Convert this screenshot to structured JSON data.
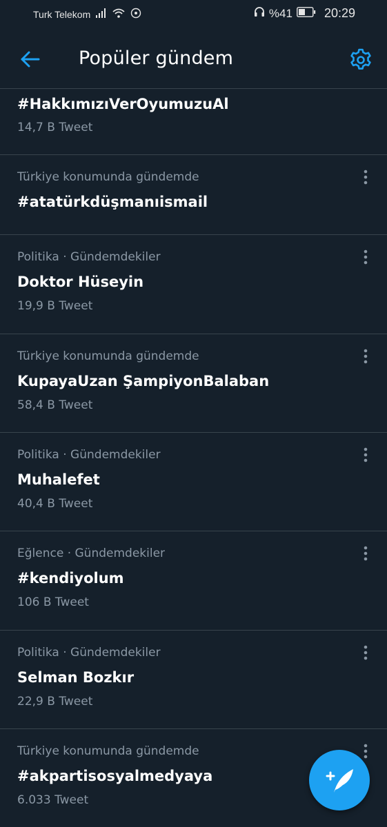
{
  "status_bar": {
    "carrier": "Turk Telekom",
    "battery": "%41",
    "time": "20:29"
  },
  "header": {
    "title": "Popüler gündem",
    "back_icon": "arrow-left-icon",
    "settings_icon": "gear-icon"
  },
  "trends": [
    {
      "context": "",
      "name": "#HakkımızıVerOyumuzuAl",
      "count": "14,7 B Tweet"
    },
    {
      "context": "Türkiye konumunda gündemde",
      "name": "#atatürkdüşmanıismail",
      "count": ""
    },
    {
      "context": "Politika · Gündemdekiler",
      "name": "Doktor Hüseyin",
      "count": "19,9 B Tweet"
    },
    {
      "context": "Türkiye konumunda gündemde",
      "name": "KupayaUzan ŞampiyonBalaban",
      "count": "58,4 B Tweet"
    },
    {
      "context": "Politika · Gündemdekiler",
      "name": "Muhalefet",
      "count": "40,4 B Tweet"
    },
    {
      "context": "Eğlence · Gündemdekiler",
      "name": "#kendiyolum",
      "count": "106 B Tweet"
    },
    {
      "context": "Politika · Gündemdekiler",
      "name": "Selman Bozkır",
      "count": "22,9 B Tweet"
    },
    {
      "context": "Türkiye konumunda gündemde",
      "name": "#akpartisosyalmedyaya",
      "count": "6.033 Tweet"
    }
  ],
  "fab": {
    "icon": "compose-tweet-icon"
  },
  "colors": {
    "background": "#15202b",
    "accent": "#1da1f2",
    "divider": "#38444d",
    "secondary_text": "#8b98a5"
  }
}
